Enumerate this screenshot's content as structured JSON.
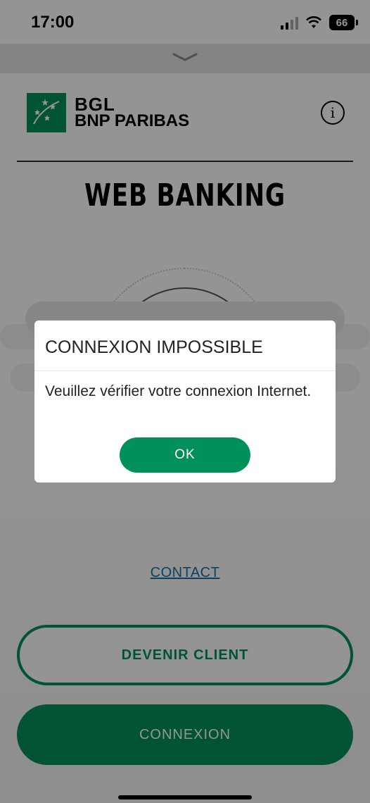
{
  "status_bar": {
    "time": "17:00",
    "battery": "66"
  },
  "header": {
    "logo_line1": "BGL",
    "logo_line2": "BNP PARIBAS",
    "info_icon": "info-icon",
    "info_glyph": "i"
  },
  "page": {
    "title": "WEB BANKING"
  },
  "footer": {
    "contact_label": "CONTACT",
    "devenir_client_label": "DEVENIR CLIENT",
    "connexion_label": "CONNEXION"
  },
  "dialog": {
    "title": "CONNEXION IMPOSSIBLE",
    "message": "Veuillez vérifier votre connexion Internet.",
    "ok_label": "OK"
  },
  "colors": {
    "brand_green": "#00915a",
    "link_blue": "#1a6ea8",
    "overlay": "rgba(0,0,0,0.42)"
  }
}
